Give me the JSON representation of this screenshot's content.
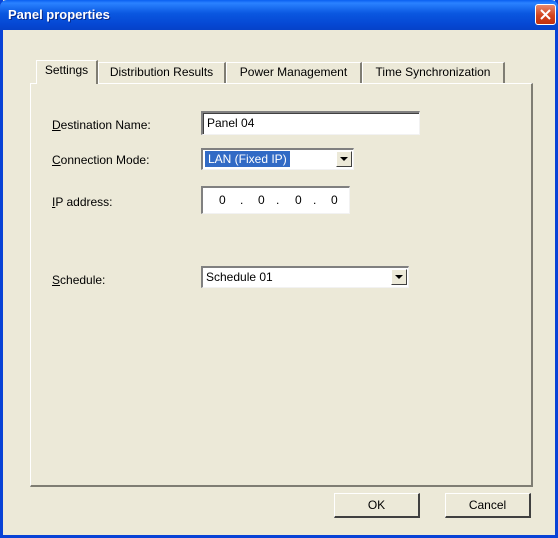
{
  "window": {
    "title": "Panel properties"
  },
  "tabs": [
    {
      "label": "Settings"
    },
    {
      "label": "Distribution Results"
    },
    {
      "label": "Power Management"
    },
    {
      "label": "Time Synchronization"
    }
  ],
  "settings": {
    "destination_name_label": "Destination Name:",
    "destination_name_value": "Panel 04",
    "connection_mode_label": "Connection Mode:",
    "connection_mode_value": "LAN (Fixed IP)",
    "ip_address_label": "IP address:",
    "ip_octets": [
      "0",
      "0",
      "0",
      "0"
    ],
    "ip_dot": ".",
    "schedule_label": "Schedule:",
    "schedule_value": "Schedule 01"
  },
  "buttons": {
    "ok": "OK",
    "cancel": "Cancel"
  },
  "colors": {
    "titlebar": "#0a57e0",
    "dialog_bg": "#ece9d8",
    "selection": "#316ac5"
  }
}
